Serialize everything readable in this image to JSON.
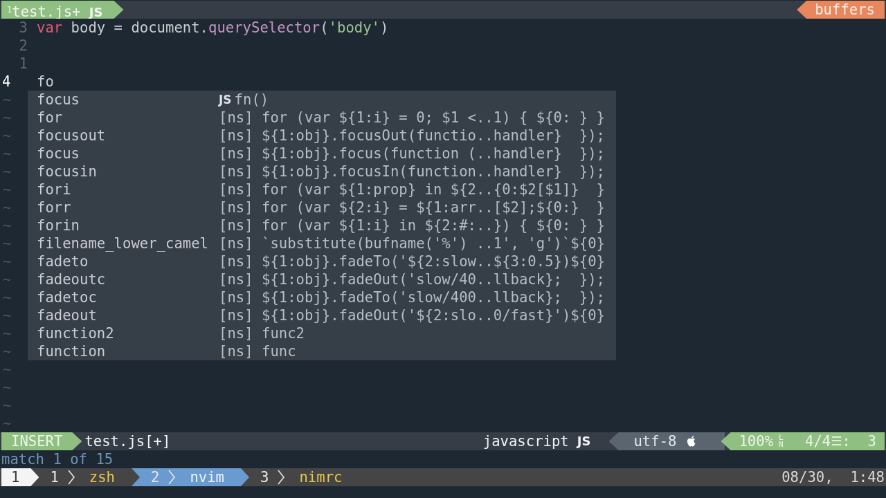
{
  "tabline": {
    "buffers": [
      {
        "number": "1",
        "name": "test.js+",
        "badge": "JS",
        "selected": true
      }
    ],
    "label": "buffers"
  },
  "editor": {
    "lines": [
      {
        "number": "3",
        "current": false,
        "tokens": [
          {
            "kind": "keyword",
            "text": "var"
          },
          {
            "kind": "plain",
            "text": " body = document."
          },
          {
            "kind": "function",
            "text": "querySelector"
          },
          {
            "kind": "plain",
            "text": "("
          },
          {
            "kind": "string",
            "text": "'body'"
          },
          {
            "kind": "plain",
            "text": ")"
          }
        ]
      },
      {
        "number": "2",
        "current": false
      },
      {
        "number": "1",
        "current": false
      },
      {
        "number": "4",
        "current": true,
        "tokens": [
          {
            "kind": "plain",
            "text": "fo"
          }
        ]
      }
    ],
    "filler": [
      "~",
      "~",
      "~",
      "~",
      "~",
      "~",
      "~",
      "~",
      "~",
      "~",
      "~",
      "~",
      "~",
      "~",
      "~",
      "~",
      "~",
      "~",
      "~"
    ]
  },
  "completion": {
    "items": [
      {
        "word": "focus",
        "badge": "JS",
        "menu": "fn()"
      },
      {
        "word": "for",
        "menu": "[ns] for (var ${1:i} = 0; $1 <..1) { ${0: } }"
      },
      {
        "word": "focusout",
        "menu": "[ns] ${1:obj}.focusOut(functio..handler}  });"
      },
      {
        "word": "focus",
        "menu": "[ns] ${1:obj}.focus(function (..handler}  });"
      },
      {
        "word": "focusin",
        "menu": "[ns] ${1:obj}.focusIn(function..handler}  });"
      },
      {
        "word": "fori",
        "menu": "[ns] for (var ${1:prop} in ${2..{0:$2[$1]}  }"
      },
      {
        "word": "forr",
        "menu": "[ns] for (var ${2:i} = ${1:arr..[$2];${0:}  }"
      },
      {
        "word": "forin",
        "menu": "[ns] for (var ${1:i} in ${2:#:..}) { ${0: } }"
      },
      {
        "word": "filename_lower_camel",
        "menu": "[ns] `substitute(bufname('%') ..1', 'g')`${0}"
      },
      {
        "word": "fadeto",
        "menu": "[ns] ${1:obj}.fadeTo('${2:slow..${3:0.5})${0}"
      },
      {
        "word": "fadeoutc",
        "menu": "[ns] ${1:obj}.fadeOut('slow/40..llback};  });"
      },
      {
        "word": "fadetoc",
        "menu": "[ns] ${1:obj}.fadeTo('slow/400..llback};  });"
      },
      {
        "word": "fadeout",
        "menu": "[ns] ${1:obj}.fadeOut('${2:slo..0/fast}')${0}"
      },
      {
        "word": "function2",
        "menu": "[ns] func2"
      },
      {
        "word": "function",
        "menu": "[ns] func"
      }
    ]
  },
  "statusline": {
    "mode": "INSERT",
    "file": "test.js[+]",
    "filetype": "javascript",
    "filetype_badge": "JS",
    "encoding": "utf-8",
    "percent": "100%",
    "line_label": "LN",
    "position": "4/4",
    "lines_glyph": "☰",
    "column": ":  3"
  },
  "cmdline": "match 1 of 15",
  "tmux": {
    "session": "1",
    "windows": [
      {
        "index": "1",
        "name": "zsh",
        "selected": false
      },
      {
        "index": "2",
        "name": "nvim",
        "selected": true
      },
      {
        "index": "3",
        "name": "nimrc",
        "selected": false
      }
    ],
    "clock": "08/30,  1:48"
  }
}
